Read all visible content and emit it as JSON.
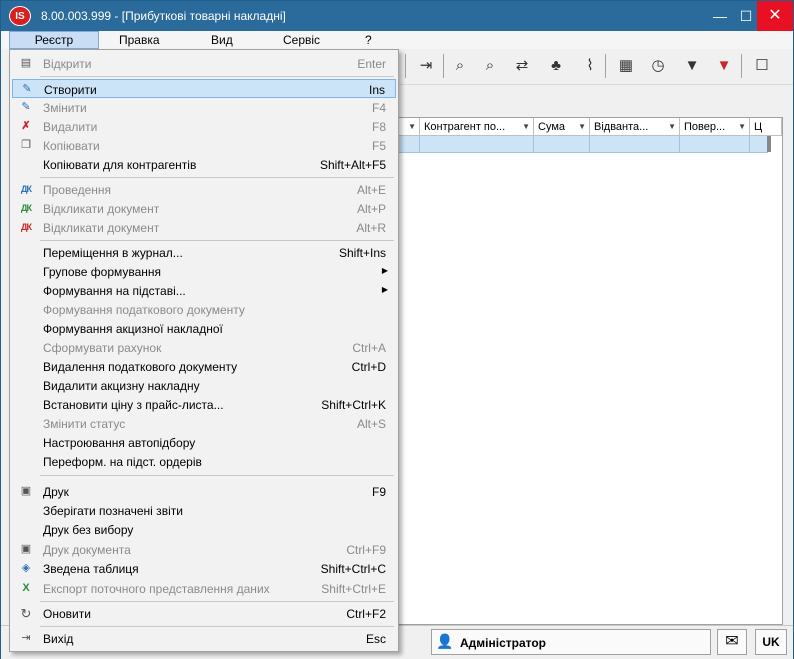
{
  "window": {
    "title": "8.00.003.999 - [Прибуткові товарні накладні]",
    "icon_text": "IS",
    "min": "—",
    "max": "☐",
    "close": "✕"
  },
  "menubar": [
    "Реєстр",
    "Правка",
    "Вид",
    "Сервіс",
    "?"
  ],
  "menu": {
    "items": [
      {
        "label": "Відкрити",
        "shortcut": "Enter",
        "disabled": true,
        "icon": "open-icon",
        "glyph": "📂"
      },
      {
        "label": "Створити",
        "shortcut": "Ins",
        "disabled": false,
        "highlighted": true,
        "icon": "create-icon",
        "glyph": "✎"
      },
      {
        "label": "Змінити",
        "shortcut": "F4",
        "disabled": true,
        "icon": "edit-icon",
        "glyph": "✎"
      },
      {
        "label": "Видалити",
        "shortcut": "F8",
        "disabled": true,
        "icon": "delete-icon",
        "glyph": "✗"
      },
      {
        "label": "Копіювати",
        "shortcut": "F5",
        "disabled": true,
        "icon": "copy-icon",
        "glyph": "❐"
      },
      {
        "label": "Копіювати для контрагентів",
        "shortcut": "Shift+Alt+F5",
        "disabled": false,
        "icon": "",
        "glyph": ""
      },
      {
        "label": "Проведення",
        "shortcut": "Alt+E",
        "disabled": true,
        "icon": "posting-icon",
        "glyph": "ДК"
      },
      {
        "label": "Відкликати документ",
        "shortcut": "Alt+P",
        "disabled": true,
        "icon": "recall-green-icon",
        "glyph": "ДК"
      },
      {
        "label": "Відкликати документ",
        "shortcut": "Alt+R",
        "disabled": true,
        "icon": "recall-red-icon",
        "glyph": "ДК"
      },
      {
        "label": "Переміщення в журнал...",
        "shortcut": "Shift+Ins",
        "disabled": false,
        "icon": "",
        "glyph": ""
      },
      {
        "label": "Групове формування",
        "shortcut": "",
        "submenu": true,
        "disabled": false,
        "icon": "",
        "glyph": ""
      },
      {
        "label": "Формування на підставі...",
        "shortcut": "",
        "submenu": true,
        "disabled": false,
        "icon": "",
        "glyph": ""
      },
      {
        "label": "Формування податкового документу",
        "shortcut": "",
        "disabled": true,
        "icon": "",
        "glyph": ""
      },
      {
        "label": "Формування акцизної накладної",
        "shortcut": "",
        "disabled": false,
        "icon": "",
        "glyph": ""
      },
      {
        "label": "Сформувати рахунок",
        "shortcut": "Ctrl+A",
        "disabled": true,
        "icon": "",
        "glyph": ""
      },
      {
        "label": "Видалення податкового документу",
        "shortcut": "Ctrl+D",
        "disabled": false,
        "icon": "",
        "glyph": ""
      },
      {
        "label": "Видалити акцизну накладну",
        "shortcut": "",
        "disabled": false,
        "icon": "",
        "glyph": ""
      },
      {
        "label": "Встановити ціну з прайс-листа...",
        "shortcut": "Shift+Ctrl+K",
        "disabled": false,
        "icon": "",
        "glyph": ""
      },
      {
        "label": "Змінити статус",
        "shortcut": "Alt+S",
        "disabled": true,
        "icon": "",
        "glyph": ""
      },
      {
        "label": "Настроювання  автопідбору",
        "shortcut": "",
        "disabled": false,
        "icon": "",
        "glyph": ""
      },
      {
        "label": "Переформ. на підст. ордерів",
        "shortcut": "",
        "disabled": false,
        "icon": "",
        "glyph": ""
      },
      {
        "label": "Друк",
        "shortcut": "F9",
        "disabled": false,
        "icon": "print-icon",
        "glyph": "🖶"
      },
      {
        "label": "Зберігати позначені звіти",
        "shortcut": "",
        "disabled": false,
        "icon": "",
        "glyph": ""
      },
      {
        "label": "Друк без вибору",
        "shortcut": "",
        "disabled": false,
        "icon": "",
        "glyph": ""
      },
      {
        "label": "Друк документа",
        "shortcut": "Ctrl+F9",
        "disabled": true,
        "icon": "print-doc-icon",
        "glyph": "🖶"
      },
      {
        "label": "Зведена таблиця",
        "shortcut": "Shift+Ctrl+C",
        "disabled": false,
        "icon": "pivot-table-icon",
        "glyph": "◈"
      },
      {
        "label": "Експорт поточного представлення даних",
        "shortcut": "Shift+Ctrl+E",
        "disabled": true,
        "icon": "excel-export-icon",
        "glyph": "X"
      },
      {
        "label": "Оновити",
        "shortcut": "Ctrl+F2",
        "disabled": false,
        "icon": "refresh-icon",
        "glyph": "↻"
      },
      {
        "label": "Вихід",
        "shortcut": "Esc",
        "disabled": false,
        "icon": "exit-icon",
        "glyph": "⇥"
      }
    ]
  },
  "grid": {
    "columns": [
      "",
      "Контрагент по...",
      "Сума",
      "Відванта...",
      "Повер...",
      "Ц"
    ]
  },
  "toolbar": {
    "icons": [
      "exit-door-icon",
      "find-icon",
      "find-next-icon",
      "transfer-icon",
      "tree-icon",
      "attach-icon",
      "table-icon",
      "clock-icon",
      "filter-icon",
      "clear-filter-icon",
      "panel-icon"
    ],
    "glyphs": [
      "⇥",
      "⌕",
      "⌕",
      "⇄",
      "♣",
      "⌇",
      "▦",
      "◷",
      "▼",
      "▼",
      "☐"
    ]
  },
  "status": {
    "user": "Адміністратор",
    "lang": "UK",
    "mail_glyph": "✉",
    "user_glyph": "👤"
  },
  "colors": {
    "titlebar": "#2b6b9c",
    "highlight": "#cce4f7",
    "selected_row": "#cde4f7"
  }
}
